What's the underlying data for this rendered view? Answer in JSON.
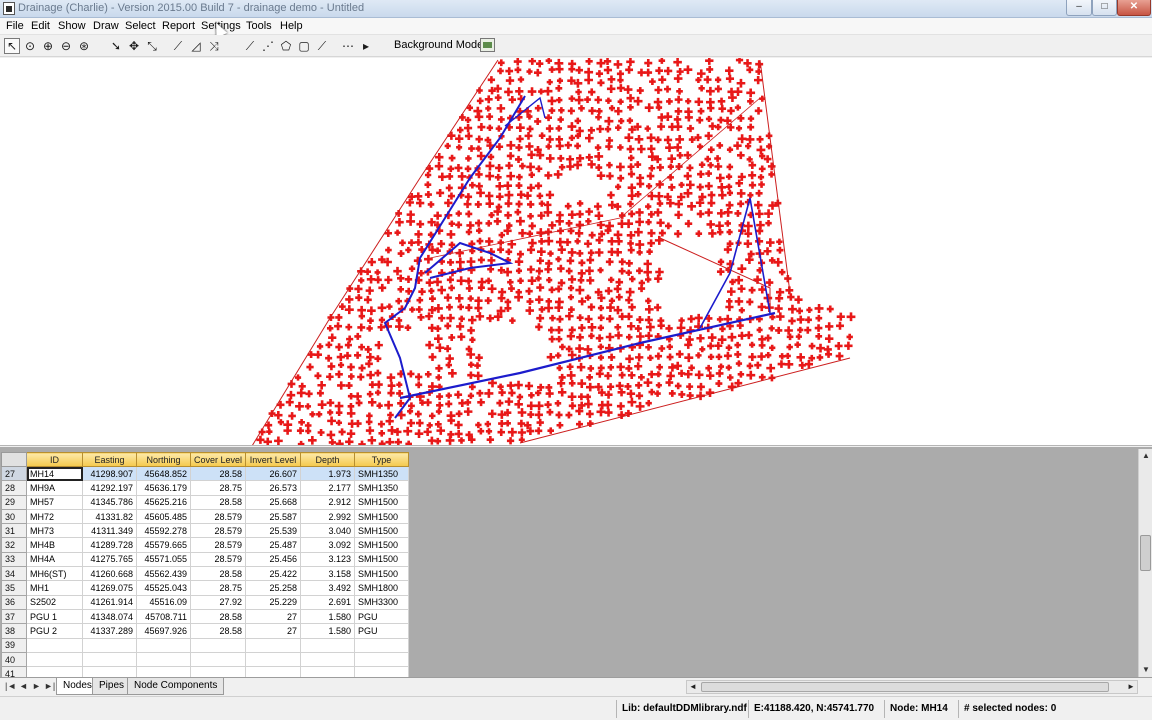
{
  "window": {
    "title": "Drainage (Charlie) - Version 2015.00 Build 7 - drainage demo - Untitled",
    "minimize": "–",
    "maximize": "□",
    "close": "✕"
  },
  "menu": [
    "File",
    "Edit",
    "Show",
    "Draw",
    "Select",
    "Report",
    "Settings",
    "Tools",
    "Help"
  ],
  "toolbar": {
    "buttons": [
      "pointer-icon",
      "zoom-window-icon",
      "zoom-in-icon",
      "zoom-out-icon",
      "zoom-extents-icon",
      "select-arrow-icon",
      "pan-icon",
      "select-pipe-icon",
      "draw-node-icon",
      "draw-pipe-icon",
      "split-pipe-icon",
      "measure-icon",
      "area-icon",
      "polygon-icon",
      "rectangle-icon",
      "line-icon",
      "grid-icon",
      "select-all-icon"
    ],
    "background_models_label": "Background Models:"
  },
  "table": {
    "columns": [
      "ID",
      "Easting",
      "Northing",
      "Cover Level",
      "Invert Level",
      "Depth",
      "Type"
    ],
    "rows": [
      {
        "n": "27",
        "id": "MH14",
        "easting": "41298.907",
        "northing": "45648.852",
        "cover": "28.58",
        "invert": "26.607",
        "depth": "1.973",
        "type": "SMH1350"
      },
      {
        "n": "28",
        "id": "MH9A",
        "easting": "41292.197",
        "northing": "45636.179",
        "cover": "28.75",
        "invert": "26.573",
        "depth": "2.177",
        "type": "SMH1350"
      },
      {
        "n": "29",
        "id": "MH57",
        "easting": "41345.786",
        "northing": "45625.216",
        "cover": "28.58",
        "invert": "25.668",
        "depth": "2.912",
        "type": "SMH1500"
      },
      {
        "n": "30",
        "id": "MH72",
        "easting": "41331.82",
        "northing": "45605.485",
        "cover": "28.579",
        "invert": "25.587",
        "depth": "2.992",
        "type": "SMH1500"
      },
      {
        "n": "31",
        "id": "MH73",
        "easting": "41311.349",
        "northing": "45592.278",
        "cover": "28.579",
        "invert": "25.539",
        "depth": "3.040",
        "type": "SMH1500"
      },
      {
        "n": "32",
        "id": "MH4B",
        "easting": "41289.728",
        "northing": "45579.665",
        "cover": "28.579",
        "invert": "25.487",
        "depth": "3.092",
        "type": "SMH1500"
      },
      {
        "n": "33",
        "id": "MH4A",
        "easting": "41275.765",
        "northing": "45571.055",
        "cover": "28.579",
        "invert": "25.456",
        "depth": "3.123",
        "type": "SMH1500"
      },
      {
        "n": "34",
        "id": "MH6(ST)",
        "easting": "41260.668",
        "northing": "45562.439",
        "cover": "28.58",
        "invert": "25.422",
        "depth": "3.158",
        "type": "SMH1500"
      },
      {
        "n": "35",
        "id": "MH1",
        "easting": "41269.075",
        "northing": "45525.043",
        "cover": "28.75",
        "invert": "25.258",
        "depth": "3.492",
        "type": "SMH1800"
      },
      {
        "n": "36",
        "id": "S2502",
        "easting": "41261.914",
        "northing": "45516.09",
        "cover": "27.92",
        "invert": "25.229",
        "depth": "2.691",
        "type": "SMH3300"
      },
      {
        "n": "37",
        "id": "PGU 1",
        "easting": "41348.074",
        "northing": "45708.711",
        "cover": "28.58",
        "invert": "27",
        "depth": "1.580",
        "type": "PGU"
      },
      {
        "n": "38",
        "id": "PGU 2",
        "easting": "41337.289",
        "northing": "45697.926",
        "cover": "28.58",
        "invert": "27",
        "depth": "1.580",
        "type": "PGU"
      },
      {
        "n": "39",
        "id": "",
        "easting": "",
        "northing": "",
        "cover": "",
        "invert": "",
        "depth": "",
        "type": ""
      },
      {
        "n": "40",
        "id": "",
        "easting": "",
        "northing": "",
        "cover": "",
        "invert": "",
        "depth": "",
        "type": ""
      },
      {
        "n": "41",
        "id": "",
        "easting": "",
        "northing": "",
        "cover": "",
        "invert": "",
        "depth": "",
        "type": ""
      }
    ]
  },
  "tabs": {
    "nav": [
      "|◄",
      "◄",
      "►",
      "►|"
    ],
    "items": [
      "Nodes",
      "Pipes",
      "Node Components"
    ],
    "active": "Nodes"
  },
  "status": {
    "lib": "Lib: defaultDDMlibrary.ndf",
    "coords": "E:41188.420, N:45741.770",
    "node": "Node: MH14",
    "selected": "# selected nodes: 0"
  },
  "colors": {
    "node_marker": "#e81818",
    "pipe_main": "#1c1ccc",
    "pipe_secondary": "#cc1e1e",
    "grid_header": "#f4c94c",
    "active_row": "#cde1f7"
  }
}
